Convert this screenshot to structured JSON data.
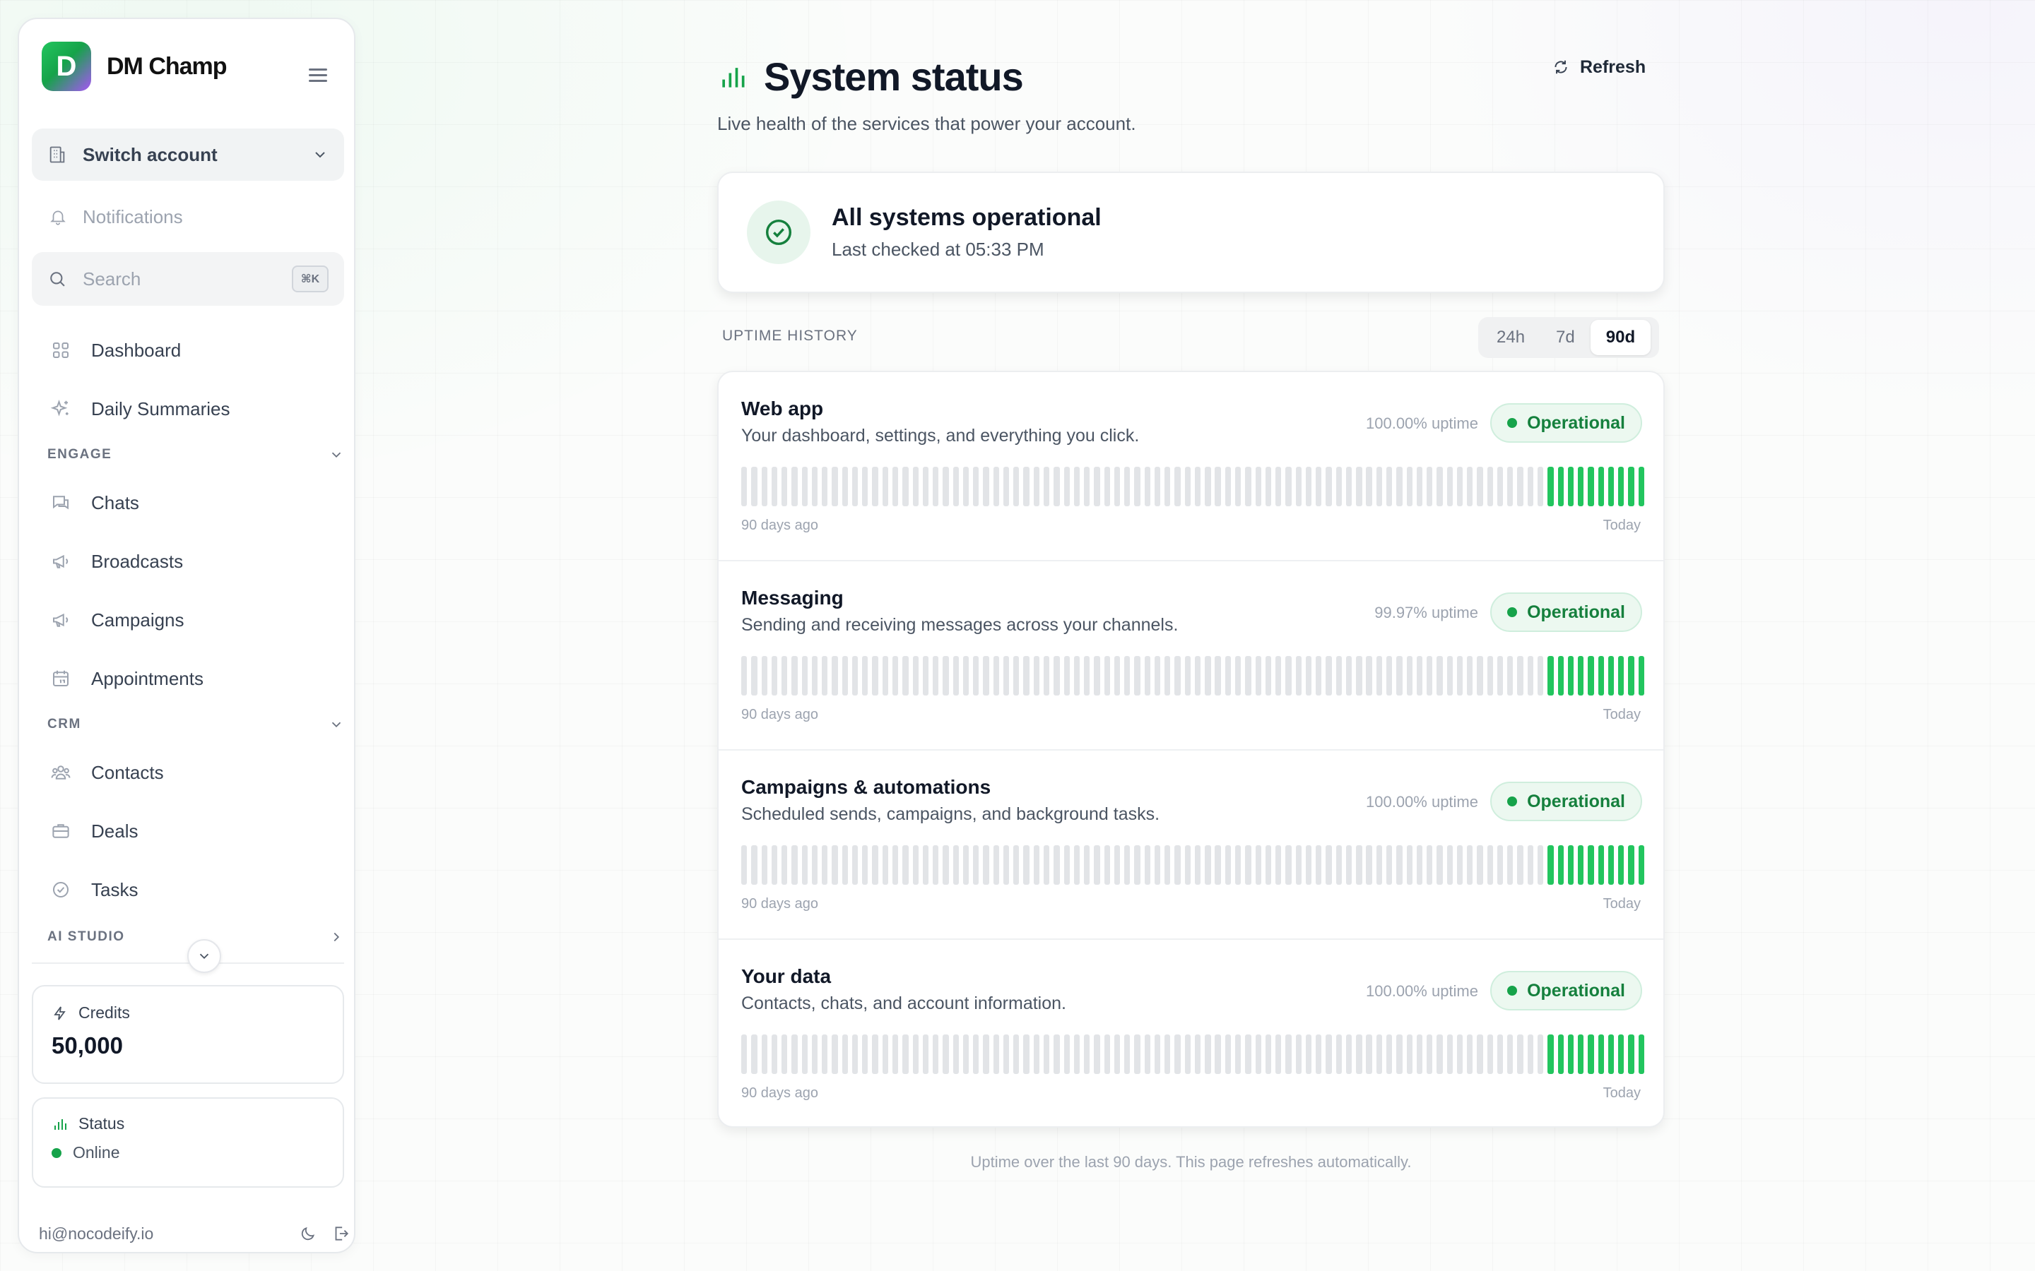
{
  "brand": {
    "name": "DM Champ",
    "logo_letter": "D"
  },
  "sidebar": {
    "switch_account": "Switch account",
    "notifications": "Notifications",
    "search": {
      "label": "Search",
      "shortcut": "⌘K"
    },
    "items_top": [
      {
        "label": "Dashboard",
        "icon": "grid-icon"
      },
      {
        "label": "Daily Summaries",
        "icon": "sparkles-icon"
      }
    ],
    "sections": [
      {
        "title": "ENGAGE",
        "items": [
          {
            "label": "Chats",
            "icon": "chat-icon"
          },
          {
            "label": "Broadcasts",
            "icon": "megaphone-icon"
          },
          {
            "label": "Campaigns",
            "icon": "megaphone-icon"
          },
          {
            "label": "Appointments",
            "icon": "calendar-icon"
          }
        ]
      },
      {
        "title": "CRM",
        "items": [
          {
            "label": "Contacts",
            "icon": "users-icon"
          },
          {
            "label": "Deals",
            "icon": "briefcase-icon"
          },
          {
            "label": "Tasks",
            "icon": "check-circle-icon"
          }
        ]
      },
      {
        "title": "AI STUDIO",
        "items": []
      }
    ],
    "credits": {
      "label": "Credits",
      "value": "50,000"
    },
    "status": {
      "label": "Status",
      "value": "Online"
    },
    "email": "hi@nocodeify.io"
  },
  "main": {
    "title": "System status",
    "subtitle": "Live health of the services that power your account.",
    "refresh_label": "Refresh",
    "summary": {
      "title": "All systems operational",
      "subtitle": "Last checked at 05:33 PM"
    },
    "uptime_history_label": "UPTIME HISTORY",
    "ranges": [
      "24h",
      "7d",
      "90d"
    ],
    "active_range": "90d",
    "services": [
      {
        "name": "Web app",
        "description": "Your dashboard, settings, and everything you click.",
        "uptime": "100.00% uptime",
        "status": "Operational",
        "start_label": "90 days ago",
        "end_label": "Today",
        "days_total": 90,
        "days_with_data": 10
      },
      {
        "name": "Messaging",
        "description": "Sending and receiving messages across your channels.",
        "uptime": "99.97% uptime",
        "status": "Operational",
        "start_label": "90 days ago",
        "end_label": "Today",
        "days_total": 90,
        "days_with_data": 10
      },
      {
        "name": "Campaigns & automations",
        "description": "Scheduled sends, campaigns, and background tasks.",
        "uptime": "100.00% uptime",
        "status": "Operational",
        "start_label": "90 days ago",
        "end_label": "Today",
        "days_total": 90,
        "days_with_data": 10
      },
      {
        "name": "Your data",
        "description": "Contacts, chats, and account information.",
        "uptime": "100.00% uptime",
        "status": "Operational",
        "start_label": "90 days ago",
        "end_label": "Today",
        "days_total": 90,
        "days_with_data": 10
      }
    ],
    "footer": "Uptime over the last 90 days. This page refreshes automatically."
  },
  "colors": {
    "accent": "#16a34a",
    "bar_ok": "#22c55e",
    "bar_empty": "#e2e4e7",
    "badge_bg": "#ecf8f0"
  }
}
